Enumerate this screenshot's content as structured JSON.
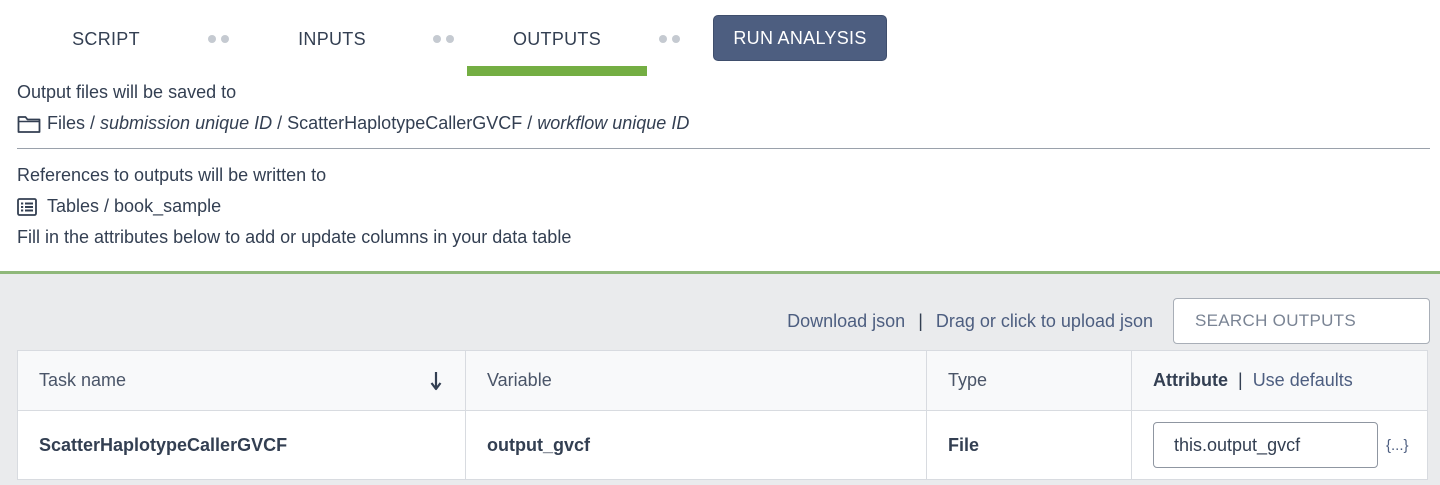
{
  "tabs": {
    "script": "SCRIPT",
    "inputs": "INPUTS",
    "outputs": "OUTPUTS",
    "run": "RUN ANALYSIS"
  },
  "info": {
    "files_intro": "Output files will be saved to",
    "files_root": "Files",
    "files_sep": " / ",
    "submission_id": "submission unique ID",
    "workflow_name": "ScatterHaplotypeCallerGVCF",
    "workflow_id": "workflow unique ID",
    "refs_intro": "References to outputs will be written to",
    "table_path": "Tables / book_sample",
    "fill_hint": "Fill in the attributes below to add or update columns in your data table"
  },
  "actions": {
    "download_json": "Download json",
    "separator": "|",
    "upload_json": "Drag or click to upload json",
    "search_placeholder": "SEARCH OUTPUTS"
  },
  "table": {
    "headers": {
      "task_name": "Task name",
      "variable": "Variable",
      "type": "Type",
      "attribute": "Attribute",
      "attr_sep": "|",
      "use_defaults": "Use defaults"
    },
    "rows": [
      {
        "task_name": "ScatterHaplotypeCallerGVCF",
        "variable": "output_gvcf",
        "type": "File",
        "attribute": "this.output_gvcf",
        "json_btn": "{...}"
      }
    ]
  },
  "colors": {
    "accent_green": "#74ae43",
    "run_button": "#4d5e80",
    "text": "#333f52"
  },
  "icons": [
    "folder-icon",
    "table-list-icon",
    "sort-down-arrow-icon"
  ]
}
